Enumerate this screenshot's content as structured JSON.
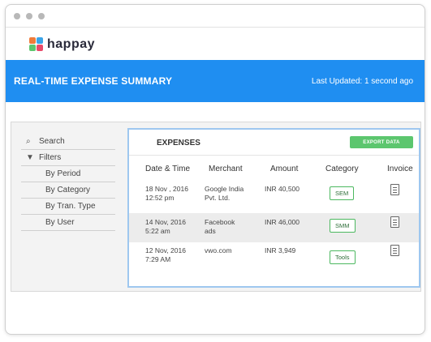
{
  "brand": {
    "name": "happay"
  },
  "banner": {
    "title": "REAL-TIME EXPENSE SUMMARY",
    "last_updated": "Last Updated: 1 second ago",
    "color": "#1f8ef1"
  },
  "sidebar": {
    "search": {
      "icon": "search-icon",
      "label": "Search"
    },
    "filters": {
      "icon": "filter-icon",
      "label": "Filters"
    },
    "items": [
      {
        "label": "By Period"
      },
      {
        "label": "By Category"
      },
      {
        "label": "By Tran. Type"
      },
      {
        "label": "By User"
      }
    ]
  },
  "panel": {
    "title": "EXPENSES",
    "export_label": "EXPORT DATA",
    "accent": "#5cc66e",
    "columns": [
      "Date & Time",
      "Merchant",
      "Amount",
      "Category",
      "Invoice"
    ],
    "rows": [
      {
        "date": "18 Nov , 2016",
        "time": "12:52 pm",
        "merchant_1": "Google India",
        "merchant_2": "Pvt. Ltd.",
        "amount": "INR 40,500",
        "category": "SEM",
        "invoice_icon": "invoice-icon"
      },
      {
        "date": "14 Nov, 2016",
        "time": "5:22 am",
        "merchant_1": "Facebook",
        "merchant_2": "ads",
        "amount": "INR 46,000",
        "category": "SMM",
        "invoice_icon": "invoice-icon"
      },
      {
        "date": "12 Nov, 2016",
        "time": "7:29 AM",
        "merchant_1": "vwo.com",
        "merchant_2": "",
        "amount": "INR 3,949",
        "category": "Tools",
        "invoice_icon": "invoice-icon"
      }
    ]
  }
}
